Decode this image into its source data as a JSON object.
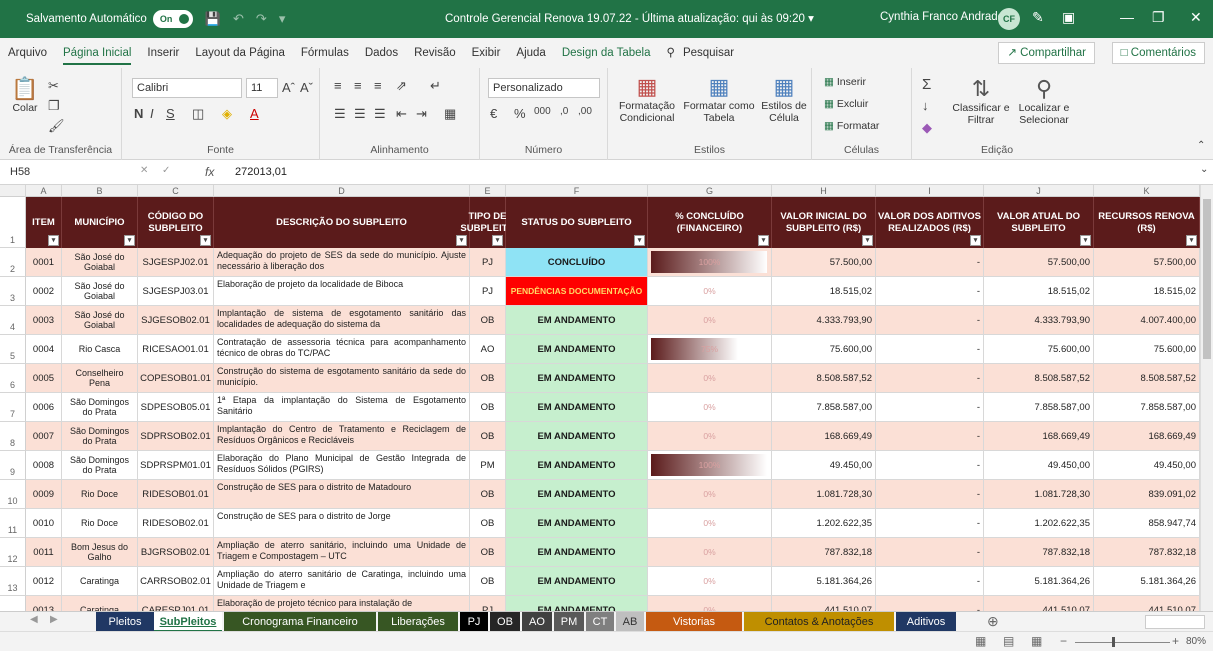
{
  "titlebar": {
    "autosave_label": "Salvamento Automático",
    "autosave_state": "On",
    "doc_title": "Controle Gerencial Renova 19.07.22  -  Última atualização: qui às 09:20  ▾",
    "user_name": "Cynthia Franco Andrade",
    "user_initials": "CF"
  },
  "menu": [
    "Arquivo",
    "Página Inicial",
    "Inserir",
    "Layout da Página",
    "Fórmulas",
    "Dados",
    "Revisão",
    "Exibir",
    "Ajuda",
    "Design da Tabela",
    "Pesquisar"
  ],
  "share_label": "Compartilhar",
  "comments_label": "Comentários",
  "ribbon": {
    "clipboard": {
      "label": "Área de Transferência",
      "paste": "Colar"
    },
    "font": {
      "label": "Fonte",
      "name": "Calibri",
      "size": "11",
      "bold": "N",
      "italic": "I",
      "underline": "S"
    },
    "alignment": {
      "label": "Alinhamento"
    },
    "number": {
      "label": "Número",
      "format": "Personalizado"
    },
    "styles": {
      "label": "Estilos",
      "cond": "Formatação Condicional",
      "table": "Formatar como Tabela",
      "cell": "Estilos de Célula"
    },
    "cells": {
      "label": "Células",
      "insert": "Inserir",
      "delete": "Excluir",
      "format": "Formatar"
    },
    "editing": {
      "label": "Edição",
      "sort": "Classificar e Filtrar",
      "find": "Localizar e Selecionar"
    }
  },
  "formula_bar": {
    "cell_ref": "H58",
    "fx": "fx",
    "value": "272013,01"
  },
  "columns": [
    "A",
    "B",
    "C",
    "D",
    "E",
    "F",
    "G",
    "H",
    "I",
    "J",
    "K"
  ],
  "headers": [
    "ITEM",
    "MUNICÍPIO",
    "CÓDIGO DO SUBPLEITO",
    "DESCRIÇÃO DO SUBPLEITO",
    "TIPO DE SUBPLEITO",
    "STATUS DO SUBPLEITO",
    "% CONCLUÍDO (FINANCEIRO)",
    "VALOR INICIAL DO SUBPLEITO (R$)",
    "VALOR DOS ADITIVOS REALIZADOS (R$)",
    "VALOR ATUAL DO SUBPLEITO",
    "RECURSOS RENOVA (R$)"
  ],
  "row_numbers": [
    "1",
    "2",
    "3",
    "4",
    "5",
    "6",
    "7",
    "8",
    "9",
    "10",
    "11",
    "12",
    "13",
    "14"
  ],
  "rows": [
    {
      "item": "0001",
      "municipio": "São José do Goiabal",
      "codigo": "SJGESPJ02.01",
      "descricao": "Adequação do projeto de SES da sede do município. Ajuste necessário à liberação dos",
      "tipo": "PJ",
      "status": "CONCLUÍDO",
      "pct": "100%",
      "pct_value": 1.0,
      "valor_inicial": "57.500,00",
      "aditivos": "-",
      "valor_atual": "57.500,00",
      "recursos": "57.500,00"
    },
    {
      "item": "0002",
      "municipio": "São José do Goiabal",
      "codigo": "SJGESPJ03.01",
      "descricao": "Elaboração de projeto da localidade de Biboca",
      "tipo": "PJ",
      "status": "PENDÊNCIAS DOCUMENTAÇÃO",
      "pct": "0%",
      "pct_value": 0,
      "valor_inicial": "18.515,02",
      "aditivos": "-",
      "valor_atual": "18.515,02",
      "recursos": "18.515,02"
    },
    {
      "item": "0003",
      "municipio": "São José do Goiabal",
      "codigo": "SJGESOB02.01",
      "descricao": "Implantação de sistema de esgotamento sanitário das localidades de adequação do sistema da",
      "tipo": "OB",
      "status": "EM ANDAMENTO",
      "pct": "0%",
      "pct_value": 0,
      "valor_inicial": "4.333.793,90",
      "aditivos": "-",
      "valor_atual": "4.333.793,90",
      "recursos": "4.007.400,00"
    },
    {
      "item": "0004",
      "municipio": "Rio Casca",
      "codigo": "RICESAO01.01",
      "descricao": "Contratação de assessoria técnica para acompanhamento técnico de obras do TC/PAC",
      "tipo": "AO",
      "status": "EM ANDAMENTO",
      "pct": "75%",
      "pct_value": 0.75,
      "valor_inicial": "75.600,00",
      "aditivos": "-",
      "valor_atual": "75.600,00",
      "recursos": "75.600,00"
    },
    {
      "item": "0005",
      "municipio": "Conselheiro Pena",
      "codigo": "COPESOB01.01",
      "descricao": "Construção do sistema de esgotamento sanitário da sede do município.",
      "tipo": "OB",
      "status": "EM ANDAMENTO",
      "pct": "0%",
      "pct_value": 0,
      "valor_inicial": "8.508.587,52",
      "aditivos": "-",
      "valor_atual": "8.508.587,52",
      "recursos": "8.508.587,52"
    },
    {
      "item": "0006",
      "municipio": "São Domingos do Prata",
      "codigo": "SDPESOB05.01",
      "descricao": "1ª Etapa da implantação do Sistema de Esgotamento Sanitário",
      "tipo": "OB",
      "status": "EM ANDAMENTO",
      "pct": "0%",
      "pct_value": 0,
      "valor_inicial": "7.858.587,00",
      "aditivos": "-",
      "valor_atual": "7.858.587,00",
      "recursos": "7.858.587,00"
    },
    {
      "item": "0007",
      "municipio": "São Domingos do Prata",
      "codigo": "SDPRSOB02.01",
      "descricao": "Implantação do Centro de Tratamento e Reciclagem de Resíduos Orgânicos e Recicláveis",
      "tipo": "OB",
      "status": "EM ANDAMENTO",
      "pct": "0%",
      "pct_value": 0,
      "valor_inicial": "168.669,49",
      "aditivos": "-",
      "valor_atual": "168.669,49",
      "recursos": "168.669,49"
    },
    {
      "item": "0008",
      "municipio": "São Domingos do Prata",
      "codigo": "SDPRSPM01.01",
      "descricao": "Elaboração do Plano Municipal de Gestão Integrada de Resíduos Sólidos (PGIRS)",
      "tipo": "PM",
      "status": "EM ANDAMENTO",
      "pct": "100%",
      "pct_value": 1.0,
      "valor_inicial": "49.450,00",
      "aditivos": "-",
      "valor_atual": "49.450,00",
      "recursos": "49.450,00"
    },
    {
      "item": "0009",
      "municipio": "Rio Doce",
      "codigo": "RIDESOB01.01",
      "descricao": "Construção de SES para o distrito de Matadouro",
      "tipo": "OB",
      "status": "EM ANDAMENTO",
      "pct": "0%",
      "pct_value": 0,
      "valor_inicial": "1.081.728,30",
      "aditivos": "-",
      "valor_atual": "1.081.728,30",
      "recursos": "839.091,02"
    },
    {
      "item": "0010",
      "municipio": "Rio Doce",
      "codigo": "RIDESOB02.01",
      "descricao": "Construção de SES para o distrito de Jorge",
      "tipo": "OB",
      "status": "EM ANDAMENTO",
      "pct": "0%",
      "pct_value": 0,
      "valor_inicial": "1.202.622,35",
      "aditivos": "-",
      "valor_atual": "1.202.622,35",
      "recursos": "858.947,74"
    },
    {
      "item": "0011",
      "municipio": "Bom Jesus do Galho",
      "codigo": "BJGRSOB02.01",
      "descricao": "Ampliação de aterro sanitário, incluindo uma Unidade de Triagem e Compostagem – UTC",
      "tipo": "OB",
      "status": "EM ANDAMENTO",
      "pct": "0%",
      "pct_value": 0,
      "valor_inicial": "787.832,18",
      "aditivos": "-",
      "valor_atual": "787.832,18",
      "recursos": "787.832,18"
    },
    {
      "item": "0012",
      "municipio": "Caratinga",
      "codigo": "CARRSOB02.01",
      "descricao": "Ampliação do aterro sanitário de Caratinga, incluindo uma Unidade de Triagem e",
      "tipo": "OB",
      "status": "EM ANDAMENTO",
      "pct": "0%",
      "pct_value": 0,
      "valor_inicial": "5.181.364,26",
      "aditivos": "-",
      "valor_atual": "5.181.364,26",
      "recursos": "5.181.364,26"
    },
    {
      "item": "0013",
      "municipio": "Caratinga",
      "codigo": "CARESPJ01.01",
      "descricao": "Elaboração de projeto técnico para instalação de",
      "tipo": "PJ",
      "status": "EM ANDAMENTO",
      "pct": "0%",
      "pct_value": 0,
      "valor_inicial": "441.510,07",
      "aditivos": "-",
      "valor_atual": "441.510,07",
      "recursos": "441.510,07"
    }
  ],
  "colors": {
    "header_bg": "#5b1b1b",
    "concluido": "#8fe3f5",
    "pendencias": "#ff0000",
    "andamento": "#c6efce",
    "odd_row": "#fbe0d6",
    "excel_green": "#217346",
    "bar_dark": "#5b1b1b"
  },
  "sheet_tabs": [
    {
      "label": "Pleitos",
      "bg": "#203864",
      "fg": "#ffffff"
    },
    {
      "label": "SubPleitos",
      "bg": "#ffffff",
      "fg": "#217346"
    },
    {
      "label": "Cronograma Financeiro",
      "bg": "#375623",
      "fg": "#ffffff"
    },
    {
      "label": "Liberações",
      "bg": "#375623",
      "fg": "#ffffff"
    },
    {
      "label": "PJ",
      "bg": "#000000",
      "fg": "#ffffff"
    },
    {
      "label": "OB",
      "bg": "#262626",
      "fg": "#ffffff"
    },
    {
      "label": "AO",
      "bg": "#404040",
      "fg": "#ffffff"
    },
    {
      "label": "PM",
      "bg": "#595959",
      "fg": "#ffffff"
    },
    {
      "label": "CT",
      "bg": "#7f7f7f",
      "fg": "#ffffff"
    },
    {
      "label": "AB",
      "bg": "#bfbfbf",
      "fg": "#333333"
    },
    {
      "label": "Vistorias",
      "bg": "#c55a11",
      "fg": "#ffffff"
    },
    {
      "label": "Contatos & Anotações",
      "bg": "#bf8f00",
      "fg": "#222222"
    },
    {
      "label": "Aditivos",
      "bg": "#203864",
      "fg": "#ffffff"
    }
  ],
  "status_bar": {
    "zoom": "80%"
  }
}
